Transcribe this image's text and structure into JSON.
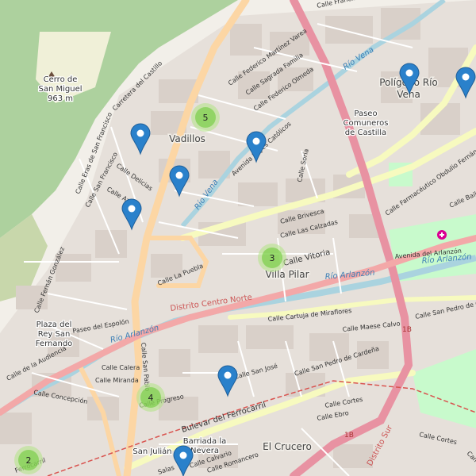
{
  "map": {
    "colors": {
      "background": "#f2efe9",
      "building": "#d9d0c9",
      "forest": "#add19e",
      "park": "#c8facc",
      "water": "#aad3df",
      "primary": "#fcd6a4",
      "motorway": "#e892a2",
      "secondary": "#f7fabf",
      "marker": "#2a81cb",
      "cluster": "#b5e28c",
      "cluster_inner": "#6ecc39"
    },
    "places": [
      {
        "text": "Cerro de"
      },
      {
        "text": "San Miguel"
      },
      {
        "text": "963 m"
      },
      {
        "text": "Vadillos"
      },
      {
        "text": "Villa Pilar"
      },
      {
        "text": "Plaza del"
      },
      {
        "text": "Rey San"
      },
      {
        "text": "Fernando"
      },
      {
        "text": "El Crucero"
      },
      {
        "text": "Barriada la"
      },
      {
        "text": "Nevera"
      },
      {
        "text": "Polígono Río"
      },
      {
        "text": "Vena"
      },
      {
        "text": "Paseo"
      },
      {
        "text": "Comuneros"
      },
      {
        "text": "de Castilla"
      },
      {
        "text": "San Julián"
      }
    ],
    "streets": [
      {
        "text": "Calle Federico Martínez Varea"
      },
      {
        "text": "Calle Sagrada Familia"
      },
      {
        "text": "Calle Federico Olmeda"
      },
      {
        "text": "Avenida Reyes Católicos"
      },
      {
        "text": "Calle Soria"
      },
      {
        "text": "Calle Brivesca"
      },
      {
        "text": "Calle Las Calzadas"
      },
      {
        "text": "Calle Vitoria"
      },
      {
        "text": "Calle Cartuja de Miraflores"
      },
      {
        "text": "Calle Maese Calvo"
      },
      {
        "text": "Calle San Pedro de Cardeña"
      },
      {
        "text": "Calle San José"
      },
      {
        "text": "Calle Calera"
      },
      {
        "text": "Calle Miranda"
      },
      {
        "text": "Calle Concepción"
      },
      {
        "text": "Calle Progreso"
      },
      {
        "text": "Calle San Pablo"
      },
      {
        "text": "Bulevar del Ferrocarril"
      },
      {
        "text": "Calle Cortes"
      },
      {
        "text": "Calle Ebro"
      },
      {
        "text": "Calle Romancero"
      },
      {
        "text": "Calle Calvario"
      },
      {
        "text": "Calle La Puebla"
      },
      {
        "text": "Paseo del Espolón"
      },
      {
        "text": "Calle Fernán González"
      },
      {
        "text": "Calle Eras de San Francisco"
      },
      {
        "text": "Calle San Francisco"
      },
      {
        "text": "Calle Delicias"
      },
      {
        "text": "Calle Azorín"
      },
      {
        "text": "Carretera del Castillo"
      },
      {
        "text": "Calle Francisco de Vitoria"
      },
      {
        "text": "Calle Farmacéutico Obdulio Fernández"
      },
      {
        "text": "Avenida del Arlanzón"
      },
      {
        "text": "Calle San Pedro de Ca"
      },
      {
        "text": "Calle Bailén"
      },
      {
        "text": "Camino"
      },
      {
        "text": "Calle de la Audiencia"
      },
      {
        "text": "Ferrocarril"
      },
      {
        "text": "Salas"
      },
      {
        "text": "Calle Cortes"
      }
    ],
    "waterways": [
      {
        "text": "Río Vena"
      },
      {
        "text": "Río Vena"
      },
      {
        "text": "Río Arlanzón"
      },
      {
        "text": "Río Arlanzón"
      },
      {
        "text": "Río Arlanzón"
      }
    ],
    "districts": [
      {
        "text": "Distrito Centro Norte"
      },
      {
        "text": "Distrito Sur"
      }
    ],
    "roads": [
      {
        "ref": "1B"
      },
      {
        "ref": "1B"
      }
    ],
    "clusters": [
      {
        "count": "5"
      },
      {
        "count": "3"
      },
      {
        "count": "4"
      },
      {
        "count": "2"
      }
    ],
    "markers_count": 8
  }
}
